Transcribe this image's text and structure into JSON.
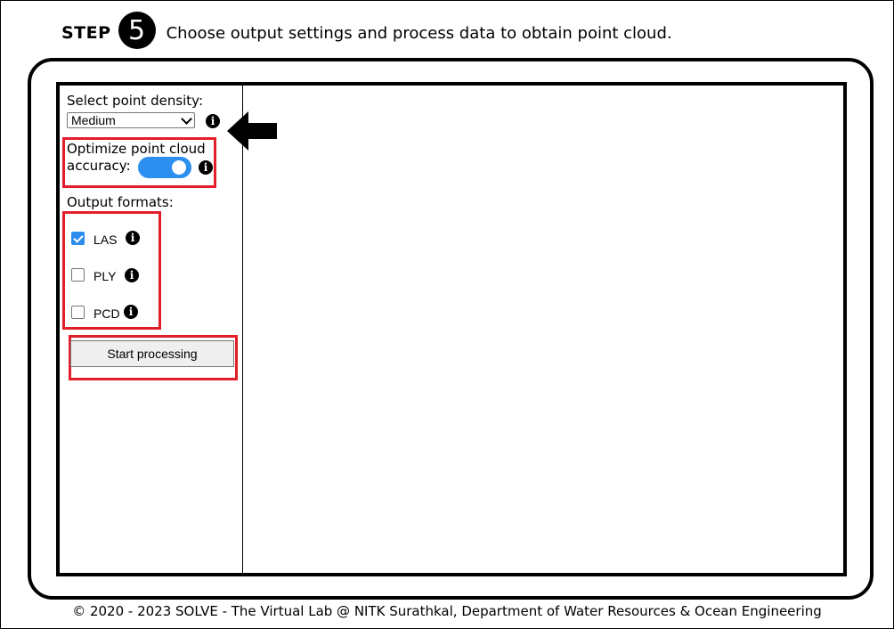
{
  "header": {
    "step_word": "STEP",
    "step_number": "5",
    "description": "Choose output settings and process data to obtain point cloud."
  },
  "settings": {
    "density_label": "Select point density:",
    "density_value": "Medium",
    "optimize_label_line1": "Optimize point cloud",
    "optimize_label_line2": "accuracy:",
    "optimize_enabled": true,
    "formats_label": "Output formats:",
    "formats": [
      {
        "label": "LAS",
        "checked": true
      },
      {
        "label": "PLY",
        "checked": false
      },
      {
        "label": "PCD",
        "checked": false
      }
    ],
    "start_button": "Start processing"
  },
  "icons": {
    "info": "i",
    "info_name": "info-icon",
    "arrow_name": "arrow-left-icon"
  },
  "colors": {
    "highlight": "#e21e2b",
    "toggle_on": "#2c8ff0",
    "checkbox_on": "#2c8ff0"
  },
  "footer": {
    "text": "© 2020 - 2023 SOLVE - The Virtual Lab @ NITK Surathkal, Department of Water Resources & Ocean Engineering"
  }
}
